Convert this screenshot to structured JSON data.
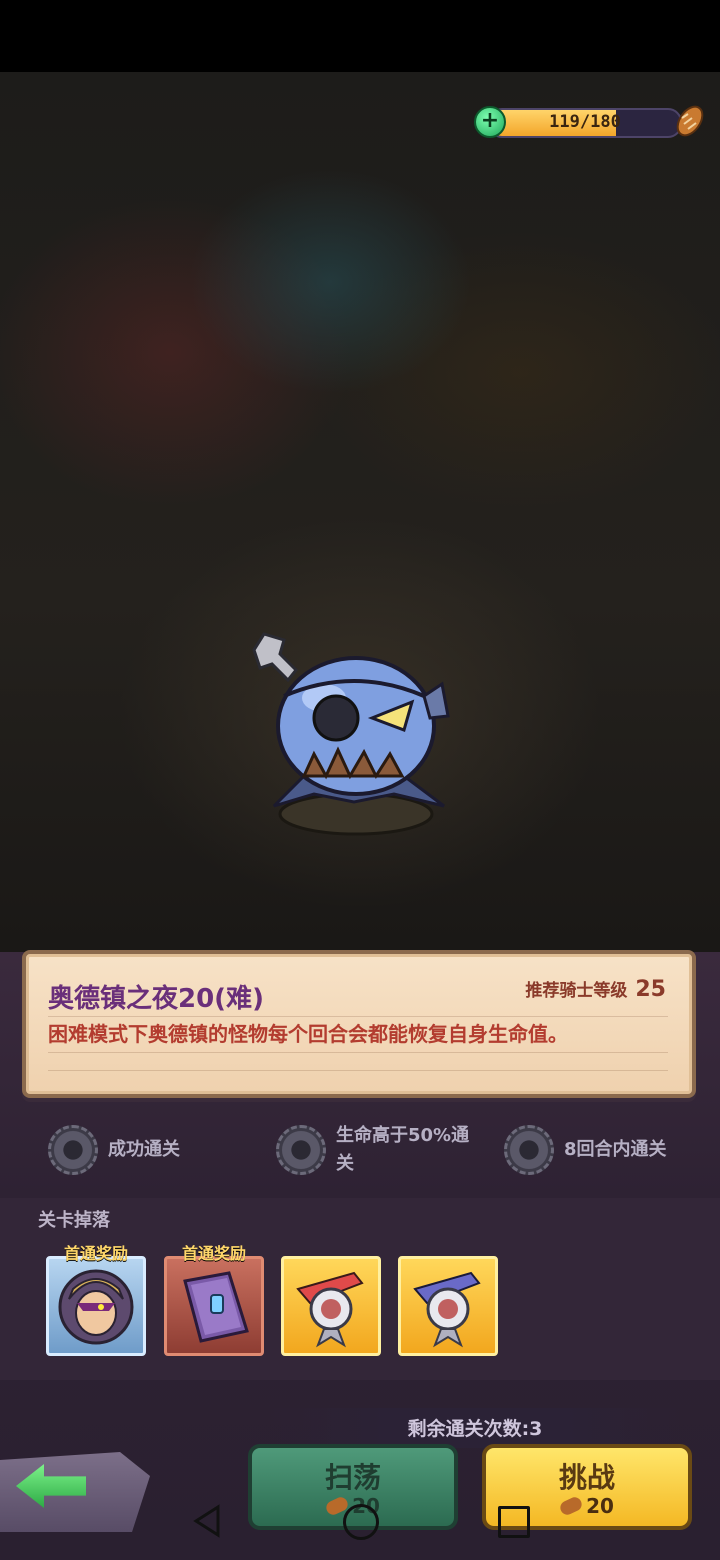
{
  "energy": {
    "value": "119/180",
    "fraction": 0.661
  },
  "stage": {
    "title": "奥德镇之夜20(难)",
    "recommend_label": "推荐骑士等级",
    "recommend_level": "25",
    "description": "困难模式下奥德镇的怪物每个回合会都能恢复自身生命值。"
  },
  "objectives": [
    {
      "text": "成功通关"
    },
    {
      "text": "生命高于50%通关"
    },
    {
      "text": "8回合内通关"
    }
  ],
  "drops": {
    "title": "关卡掉落",
    "items": [
      {
        "badge": "首通奖励",
        "icon": "hero-portrait-icon"
      },
      {
        "badge": "首通奖励",
        "icon": "spellbook-icon"
      },
      {
        "badge": "",
        "icon": "banner-emblem-icon"
      },
      {
        "badge": "",
        "icon": "banner-emblem-icon"
      }
    ]
  },
  "remaining": "剩余通关次数:3",
  "buttons": {
    "sweep": {
      "label": "扫荡",
      "cost": "20"
    },
    "challenge": {
      "label": "挑战",
      "cost": "20"
    }
  },
  "colors": {
    "accent": "#f4b824",
    "sweep": "#2c6b51",
    "title": "#6a2f7a"
  }
}
